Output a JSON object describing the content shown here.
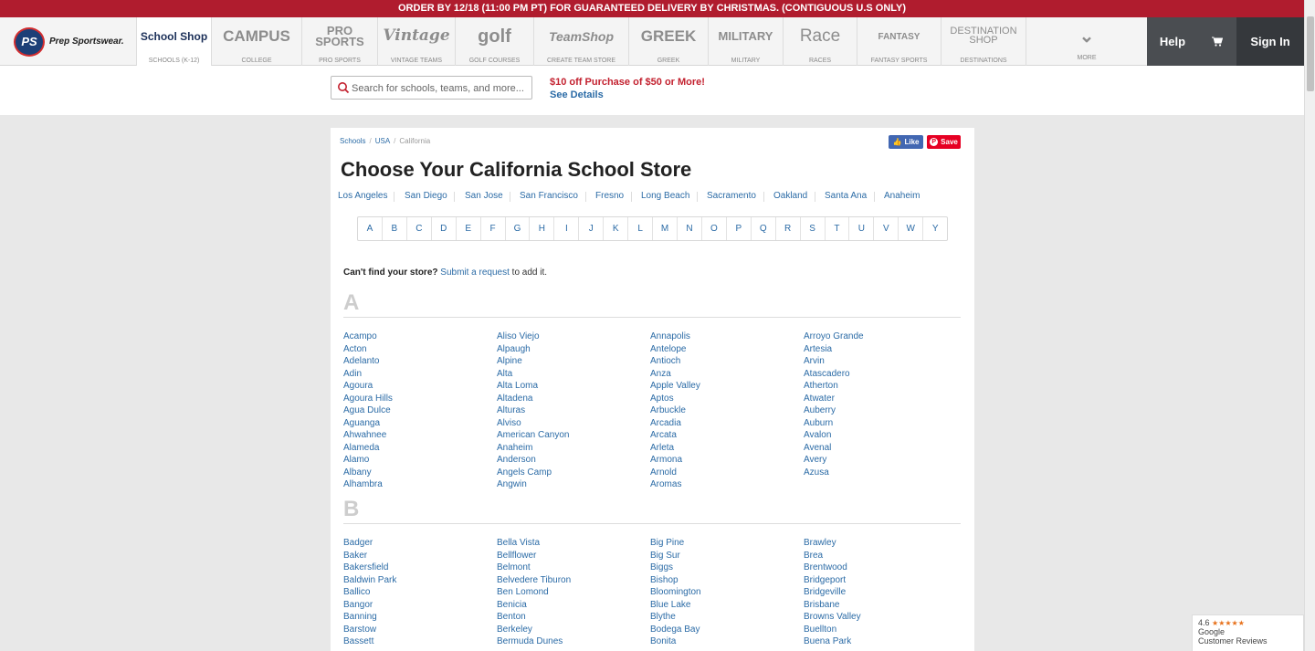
{
  "promo": "ORDER BY 12/18 (11:00 PM PT) FOR GUARANTEED DELIVERY BY CHRISTMAS. (CONTIGUOUS U.S ONLY)",
  "logo": {
    "badge": "PS",
    "name": "Prep Sportswear."
  },
  "nav": {
    "tabs": [
      {
        "mark": "School Shop",
        "caption": "SCHOOLS (K-12)"
      },
      {
        "mark": "CAMPUS",
        "caption": "COLLEGE"
      },
      {
        "mark": "PRO SPORTS",
        "caption": "PRO SPORTS"
      },
      {
        "mark": "Vintage",
        "caption": "VINTAGE TEAMS"
      },
      {
        "mark": "golf",
        "caption": "GOLF COURSES"
      },
      {
        "mark": "TeamShop",
        "caption": "CREATE TEAM STORE"
      },
      {
        "mark": "GREEK",
        "caption": "GREEK"
      },
      {
        "mark": "MILITARY",
        "caption": "MILITARY"
      },
      {
        "mark": "Race",
        "caption": "RACES"
      },
      {
        "mark": "FANTASY",
        "caption": "FANTASY SPORTS"
      },
      {
        "mark": "DESTINATION SHOP",
        "caption": "DESTINATIONS"
      },
      {
        "mark": "⌄",
        "caption": "MORE"
      }
    ],
    "help": "Help",
    "signin": "Sign In"
  },
  "search": {
    "placeholder": "Search for schools, teams, and more..."
  },
  "deal": {
    "text": "$10 off Purchase of $50 or More!",
    "link": "See Details"
  },
  "breadcrumb": {
    "schools": "Schools",
    "usa": "USA",
    "current": "California"
  },
  "social": {
    "like": "Like",
    "save": "Save"
  },
  "title": "Choose Your California School Store",
  "cities": [
    "Los Angeles",
    "San Diego",
    "San Jose",
    "San Francisco",
    "Fresno",
    "Long Beach",
    "Sacramento",
    "Oakland",
    "Santa Ana",
    "Anaheim"
  ],
  "letters": [
    "A",
    "B",
    "C",
    "D",
    "E",
    "F",
    "G",
    "H",
    "I",
    "J",
    "K",
    "L",
    "M",
    "N",
    "O",
    "P",
    "Q",
    "R",
    "S",
    "T",
    "U",
    "V",
    "W",
    "Y"
  ],
  "cant_find": {
    "question": "Can't find your store?",
    "link": "Submit a request",
    "suffix": " to add it."
  },
  "sections": [
    {
      "letter": "A",
      "columns": [
        [
          "Acampo",
          "Acton",
          "Adelanto",
          "Adin",
          "Agoura",
          "Agoura Hills",
          "Agua Dulce",
          "Aguanga",
          "Ahwahnee",
          "Alameda",
          "Alamo",
          "Albany",
          "Alhambra"
        ],
        [
          "Aliso Viejo",
          "Alpaugh",
          "Alpine",
          "Alta",
          "Alta Loma",
          "Altadena",
          "Alturas",
          "Alviso",
          "American Canyon",
          "Anaheim",
          "Anderson",
          "Angels Camp",
          "Angwin"
        ],
        [
          "Annapolis",
          "Antelope",
          "Antioch",
          "Anza",
          "Apple Valley",
          "Aptos",
          "Arbuckle",
          "Arcadia",
          "Arcata",
          "Arleta",
          "Armona",
          "Arnold",
          "Aromas"
        ],
        [
          "Arroyo Grande",
          "Artesia",
          "Arvin",
          "Atascadero",
          "Atherton",
          "Atwater",
          "Auberry",
          "Auburn",
          "Avalon",
          "Avenal",
          "Avery",
          "Azusa"
        ]
      ]
    },
    {
      "letter": "B",
      "columns": [
        [
          "Badger",
          "Baker",
          "Bakersfield",
          "Baldwin Park",
          "Ballico",
          "Bangor",
          "Banning",
          "Barstow",
          "Bassett"
        ],
        [
          "Bella Vista",
          "Bellflower",
          "Belmont",
          "Belvedere Tiburon",
          "Ben Lomond",
          "Benicia",
          "Benton",
          "Berkeley",
          "Bermuda Dunes"
        ],
        [
          "Big Pine",
          "Big Sur",
          "Biggs",
          "Bishop",
          "Bloomington",
          "Blue Lake",
          "Blythe",
          "Bodega Bay",
          "Bonita"
        ],
        [
          "Brawley",
          "Brea",
          "Brentwood",
          "Bridgeport",
          "Bridgeville",
          "Brisbane",
          "Browns Valley",
          "Buellton",
          "Buena Park"
        ]
      ]
    }
  ],
  "reviews": {
    "rating": "4.6",
    "stars": "★★★★★",
    "line1": "Google",
    "line2": "Customer Reviews"
  },
  "colors": {
    "promo": "#b01c2e",
    "link": "#2b6ba6",
    "deal": "#c3212f",
    "nav_dark": "#35383c"
  }
}
